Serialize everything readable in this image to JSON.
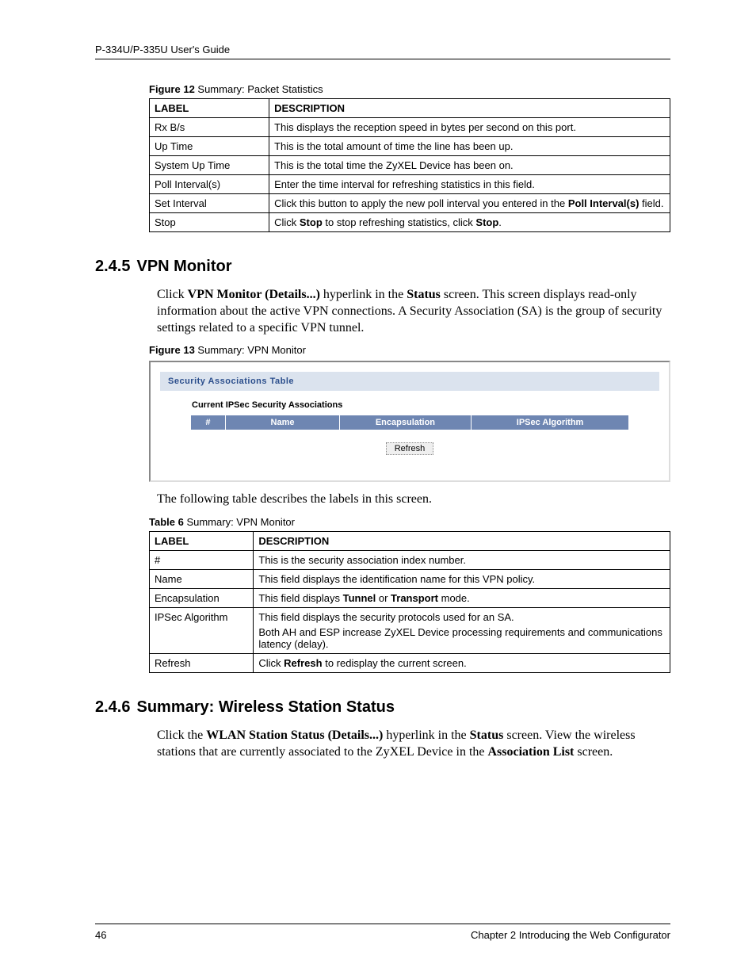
{
  "header": {
    "guide": "P-334U/P-335U User's Guide"
  },
  "figure12": {
    "caption_bold": "Figure 12",
    "caption_rest": "   Summary: Packet Statistics",
    "th_label": "LABEL",
    "th_desc": "DESCRIPTION",
    "rows": [
      {
        "label": "Rx B/s",
        "desc": "This displays the reception speed in bytes per second on this port."
      },
      {
        "label": "Up Time",
        "desc": "This is the total amount of time the line has been up."
      },
      {
        "label": "System Up Time",
        "desc": "This is the total time the ZyXEL Device has been on."
      },
      {
        "label": "Poll Interval(s)",
        "desc": "Enter the time interval for refreshing statistics in this field."
      },
      {
        "label": "Set Interval",
        "desc_pre": "Click this button to apply the new poll interval you entered in the ",
        "desc_bold": "Poll Interval(s)",
        "desc_post": " field."
      },
      {
        "label": "Stop",
        "desc_pre": "Click ",
        "desc_bold": "Stop",
        "desc_mid": " to stop refreshing statistics, click ",
        "desc_bold2": "Stop",
        "desc_post": "."
      }
    ]
  },
  "section245": {
    "num": "2.4.5",
    "title": "VPN Monitor",
    "para_parts": {
      "p1": "Click ",
      "b1": "VPN Monitor (Details...)",
      "p2": " hyperlink in the ",
      "b2": "Status",
      "p3": " screen. This screen displays read-only information about the active VPN connections. A Security Association (SA) is the group of security settings related to a specific VPN tunnel."
    }
  },
  "figure13": {
    "caption_bold": "Figure 13",
    "caption_rest": "   Summary: VPN Monitor",
    "sat_title": "Security Associations Table",
    "sat_sub": "Current IPSec Security Associations",
    "cols": {
      "c1": "#",
      "c2": "Name",
      "c3": "Encapsulation",
      "c4": "IPSec Algorithm"
    },
    "refresh": "Refresh"
  },
  "table6_intro": "The following table describes the labels in this screen.",
  "table6": {
    "caption_bold": "Table 6",
    "caption_rest": "   Summary: VPN Monitor",
    "th_label": "LABEL",
    "th_desc": "DESCRIPTION",
    "rows": [
      {
        "label": "#",
        "desc": "This is the security association index number."
      },
      {
        "label": "Name",
        "desc": "This field displays the identification name for this VPN policy."
      },
      {
        "label": "Encapsulation",
        "desc_pre": "This field displays ",
        "b1": "Tunnel",
        "mid": " or ",
        "b2": "Transport",
        "post": " mode."
      },
      {
        "label": "IPSec Algorithm",
        "desc_line1": "This field displays the security protocols used for an SA.",
        "desc_line2": "Both AH and ESP increase ZyXEL Device processing requirements and communications latency (delay)."
      },
      {
        "label": "Refresh",
        "desc_pre": "Click ",
        "b1": "Refresh",
        "post": " to redisplay the current screen."
      }
    ]
  },
  "section246": {
    "num": "2.4.6",
    "title": "Summary: Wireless Station Status",
    "para_parts": {
      "p1": "Click the ",
      "b1": "WLAN Station Status (Details...)",
      "p2": " hyperlink in the ",
      "b2": "Status",
      "p3": " screen. View the wireless stations that are currently associated to the ZyXEL Device in the ",
      "b3": "Association List",
      "p4": " screen."
    }
  },
  "footer": {
    "pagenum": "46",
    "chapter": "Chapter 2 Introducing the Web Configurator"
  }
}
